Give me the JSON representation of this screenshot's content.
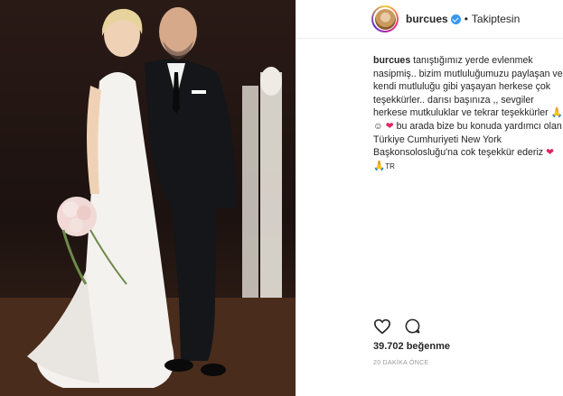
{
  "header": {
    "username": "burcues",
    "separator": "•",
    "follow_status": "Takiptesin",
    "verified_icon": "verified-badge-icon"
  },
  "caption": {
    "username": "burcues",
    "text_main": "tanıştığımız yerde evlenmek nasipmiş.. bizim mutluluğumuzu paylaşan ve kendi mutluluğu gibi yaşayan herkese çok teşekkürler.. darısı başınıza ,, sevgiler herkese mutkuluklar ve tekrar teşekkürler",
    "emoji_a": "🙏",
    "emoji_b": "☺",
    "emoji_c": "❤",
    "text_second": "bu arada bize bu konuda yardımcı olan Türkiye Cumhuriyeti New York Başkonsolosluğu'na cok teşekkür ederiz",
    "emoji_d": "❤",
    "emoji_e": "🙏",
    "suffix": "TR"
  },
  "actions": {
    "like_icon": "heart-icon",
    "comment_icon": "comment-icon"
  },
  "likes": "39.702 beğenme",
  "timestamp": "20 DAKİKA ÖNCE",
  "colors": {
    "verified": "#3897f0",
    "heart": "#e0245e",
    "text": "#262626",
    "muted": "#999999"
  }
}
